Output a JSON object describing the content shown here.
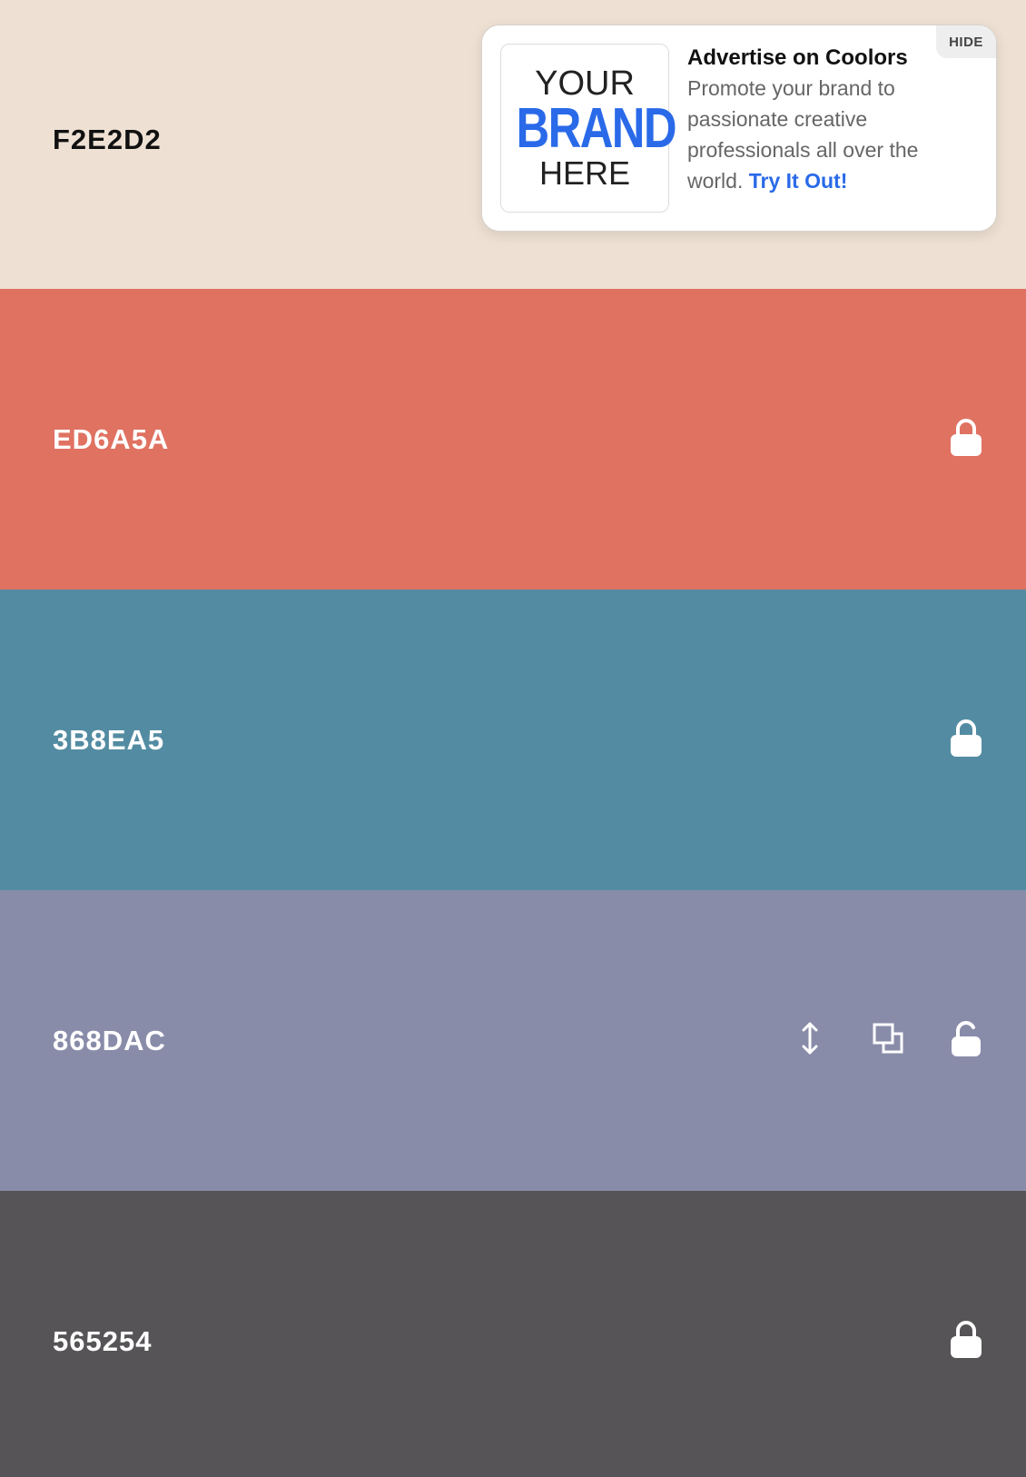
{
  "swatches": [
    {
      "hex": "F2E2D2",
      "bg": "#eee1d3",
      "fg": "#111111"
    },
    {
      "hex": "ED6A5A",
      "bg": "#e07262",
      "fg": "#ffffff"
    },
    {
      "hex": "3B8EA5",
      "bg": "#538ca2",
      "fg": "#ffffff"
    },
    {
      "hex": "868DAC",
      "bg": "#898ca9",
      "fg": "#ffffff"
    },
    {
      "hex": "565254",
      "bg": "#565456",
      "fg": "#ffffff"
    }
  ],
  "icons": {
    "locked": "lock-closed-icon",
    "unlocked": "lock-open-icon",
    "drag": "drag-vertical-icon",
    "copy": "copy-icon"
  },
  "ad": {
    "hide_label": "HIDE",
    "logo_line1": "YOUR",
    "logo_line2": "BRAND",
    "logo_line3": "HERE",
    "title": "Advertise on Coolors",
    "body": "Promote your brand to passionate creative professionals all over the world.",
    "cta": "Try It Out!",
    "accent": "#2a6ae9"
  }
}
